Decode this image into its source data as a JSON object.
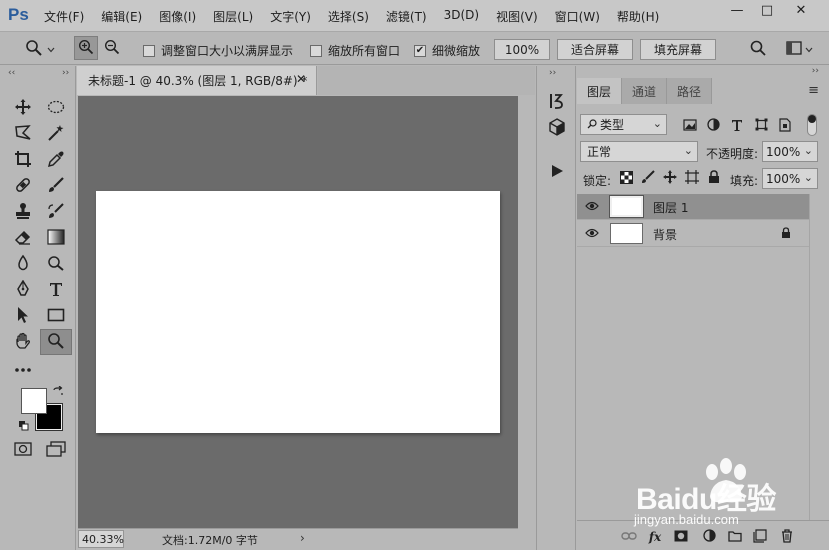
{
  "app": {
    "logo": "Ps"
  },
  "menu": [
    "文件(F)",
    "编辑(E)",
    "图像(I)",
    "图层(L)",
    "文字(Y)",
    "选择(S)",
    "滤镜(T)",
    "3D(D)",
    "视图(V)",
    "窗口(W)",
    "帮助(H)"
  ],
  "window_controls": {
    "minimize": "—",
    "maximize": "□",
    "close": "✕"
  },
  "options": {
    "resize_windows": {
      "label": "调整窗口大小以满屏显示",
      "checked": false
    },
    "zoom_all": {
      "label": "缩放所有窗口",
      "checked": false
    },
    "scrubby_zoom": {
      "label": "细微缩放",
      "checked": true
    },
    "zoom_100": "100%",
    "fit_screen": "适合屏幕",
    "fill_screen": "填充屏幕"
  },
  "document": {
    "tab_title": "未标题-1 @ 40.3% (图层 1, RGB/8#) *",
    "close": "✕",
    "canvas_color": "#ffffff",
    "pasteboard_color": "#6b6b6b"
  },
  "status": {
    "zoom": "40.33%",
    "info": "文档:1.72M/0 字节",
    "arrow": "›"
  },
  "layers_panel": {
    "tabs": [
      "图层",
      "通道",
      "路径"
    ],
    "active_tab": "图层",
    "filter_kind": "类型",
    "blend_mode": "正常",
    "opacity_label": "不透明度:",
    "opacity_value": "100%",
    "lock_label": "锁定:",
    "fill_label": "填充:",
    "fill_value": "100%",
    "layers": [
      {
        "name": "图层 1",
        "selected": true,
        "locked": false
      },
      {
        "name": "背景",
        "selected": false,
        "locked": true
      }
    ]
  },
  "watermark": {
    "brand": "Baidu经验",
    "url": "jingyan.baidu.com"
  }
}
